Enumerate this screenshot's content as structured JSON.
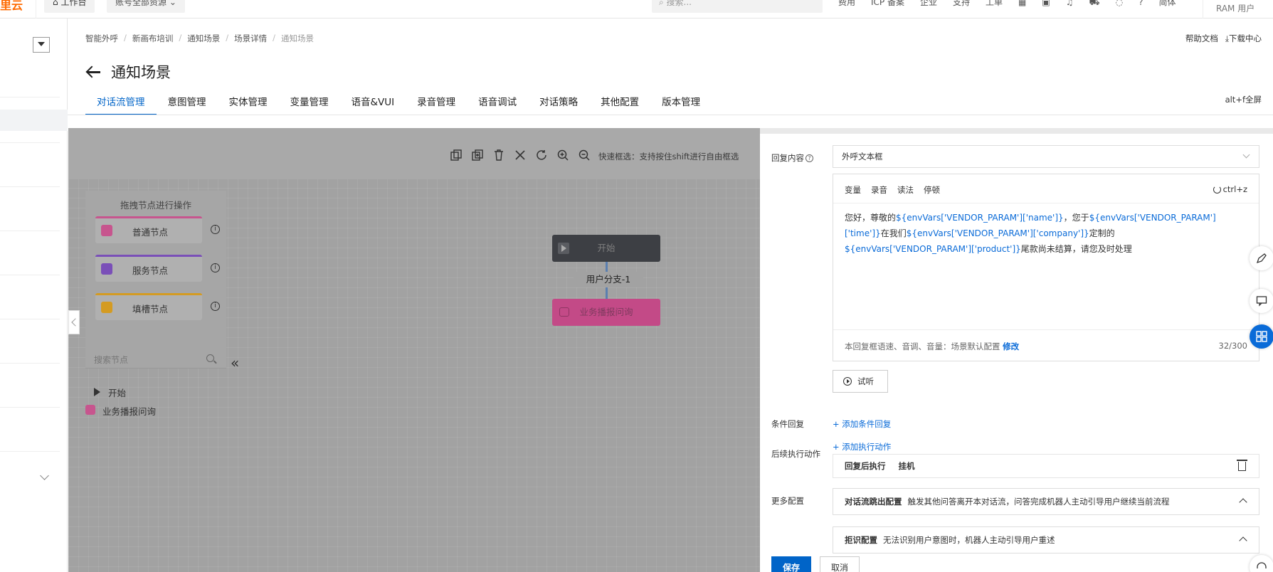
{
  "topbar": {
    "logo": "里云",
    "workbench": "工作台",
    "account": "账号全部资源",
    "search_placeholder": "搜索...",
    "links": [
      "费用",
      "ICP 备案",
      "企业",
      "支持",
      "工单"
    ],
    "lang": "简体",
    "user": "RAM 用户"
  },
  "breadcrumb": [
    "智能外呼",
    "新画布培训",
    "通知场景",
    "场景详情",
    "通知场景"
  ],
  "help": {
    "docs": "帮助文档",
    "download": "下载中心"
  },
  "page": {
    "title": "通知场景",
    "fullscreen_hint": "alt+f全屏"
  },
  "tabs": [
    "对话流管理",
    "意图管理",
    "实体管理",
    "变量管理",
    "语音&VUI",
    "录音管理",
    "语音调试",
    "对话策略",
    "其他配置",
    "版本管理"
  ],
  "canvas": {
    "quick_tip": "快速框选：支持按住shift进行自由框选",
    "node_panel_title": "拖拽节点进行操作",
    "node_types": [
      {
        "label": "普通节点",
        "color": "#c7558e"
      },
      {
        "label": "服务节点",
        "color": "#7a4fb8"
      },
      {
        "label": "填槽节点",
        "color": "#d49b22"
      }
    ],
    "search_placeholder": "搜索节点",
    "tree": [
      "开始",
      "业务播报问询"
    ],
    "flow": {
      "start": "开始",
      "branch": "用户分支-1",
      "biz": "业务播报问询"
    }
  },
  "panel": {
    "reply_label": "回复内容",
    "reply_type": "外呼文本框",
    "editor_tools": [
      "变量",
      "录音",
      "读法",
      "停顿"
    ],
    "undo": "ctrl+z",
    "text": {
      "p1": "您好，尊敬的",
      "v1": "${envVars['VENDOR_PARAM']['name']}",
      "p2": "，您于",
      "v2": "${envVars['VENDOR_PARAM']['time']}",
      "p3": "在我们",
      "v3": "${envVars['VENDOR_PARAM']['company']}",
      "p4": "定制的",
      "v4": "${envVars['VENDOR_PARAM']['product']}",
      "p5": "尾款尚未结算，请您及时处理"
    },
    "foot_text": "本回复框语速、音调、音量：场景默认配置",
    "foot_link": "修改",
    "count": "32/300",
    "listen": "试听",
    "cond_label": "条件回复",
    "cond_add": "+ 添加条件回复",
    "action_label": "后续执行动作",
    "action_add": "+ 添加执行动作",
    "action_when": "回复后执行",
    "action_value": "挂机",
    "more_label": "更多配置",
    "more": [
      {
        "title": "对话流跳出配置",
        "desc": "触发其他问答离开本对话流，问答完成机器人主动引导用户继续当前流程"
      },
      {
        "title": "拒识配置",
        "desc": "无法识别用户意图时，机器人主动引导用户重述"
      }
    ],
    "save": "保存",
    "cancel": "取消"
  }
}
